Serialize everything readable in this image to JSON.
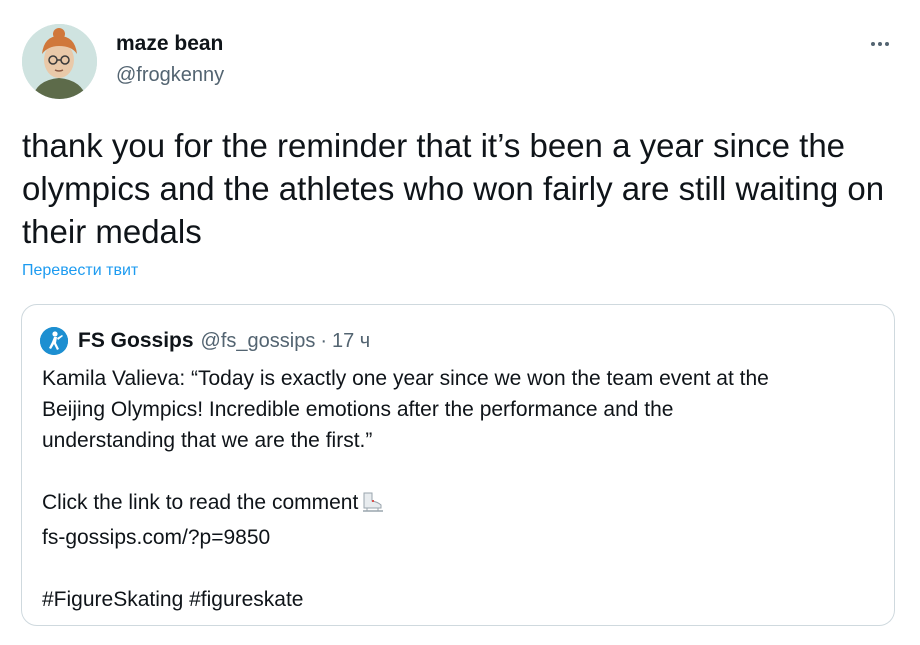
{
  "user": {
    "display_name": "maze bean",
    "handle": "@frogkenny"
  },
  "tweet": {
    "text": "thank you for the reminder that it’s been a year since the olympics and the athletes who won fairly are still waiting on their medals",
    "translate_label": "Перевести твит"
  },
  "quoted_tweet": {
    "display_name": "FS Gossips",
    "handle": "@fs_gossips",
    "separator": "·",
    "time": "17 ч",
    "lines": {
      "l1": "Kamila Valieva: “Today is exactly one year since we won the team event at the",
      "l2": "Beijing Olympics! Incredible emotions after the performance and the",
      "l3": "understanding that we are the first.”",
      "l4": "Click the link to read the comment",
      "l5": "fs-gossips.com/?p=9850",
      "l6": "#FigureSkating #figureskate"
    },
    "emoji_icon": "ice-skate-icon"
  },
  "icons": {
    "more": "more-options-icon",
    "avatar": "avatar",
    "quote_avatar": "fs-gossips-avatar"
  },
  "colors": {
    "text": "#0f1419",
    "secondary": "#536471",
    "link": "#1d9bf0",
    "border": "#cfd9de"
  }
}
